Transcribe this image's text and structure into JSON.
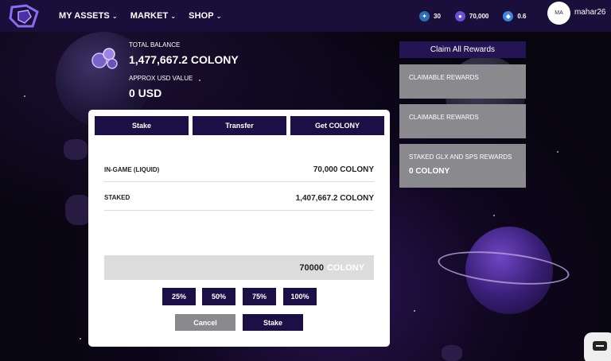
{
  "header": {
    "nav": [
      {
        "label": "MY ASSETS"
      },
      {
        "label": "MARKET"
      },
      {
        "label": "SHOP"
      }
    ],
    "stats": [
      {
        "icon": "energy-icon",
        "value": "30",
        "color": "#ffffff"
      },
      {
        "icon": "colony-coin-icon",
        "value": "70,000",
        "color": "#8a6cf0"
      },
      {
        "icon": "crystal-icon",
        "value": "0.6",
        "color": "#5aa0ff"
      }
    ],
    "avatar_initials": "MA",
    "username": "mahar26"
  },
  "balance": {
    "total_label": "TOTAL BALANCE",
    "total_value": "1,477,667.2 COLONY",
    "usd_label": "APPROX USD VALUE",
    "usd_value": "0 USD"
  },
  "rewards": {
    "claim_all": "Claim All Rewards",
    "cards": [
      {
        "title": "CLAIMABLE REWARDS",
        "value": ""
      },
      {
        "title": "CLAIMABLE REWARDS",
        "value": ""
      },
      {
        "title": "STAKED GLX AND SPS REWARDS",
        "value": "0 COLONY"
      }
    ]
  },
  "modal": {
    "tabs": [
      {
        "label": "Stake"
      },
      {
        "label": "Transfer"
      },
      {
        "label": "Get COLONY"
      }
    ],
    "rows": [
      {
        "label": "IN-GAME (LIQUID)",
        "value": "70,000 COLONY"
      },
      {
        "label": "STAKED",
        "value": "1,407,667.2 COLONY"
      }
    ],
    "amount_value": "70000",
    "amount_unit": "COLONY",
    "percent_buttons": [
      "25%",
      "50%",
      "75%",
      "100%"
    ],
    "cancel_label": "Cancel",
    "stake_label": "Stake"
  },
  "colors": {
    "header_bg": "#1a0f3a",
    "button_dark": "#1c0f45",
    "button_grey": "#8a8a8e"
  }
}
